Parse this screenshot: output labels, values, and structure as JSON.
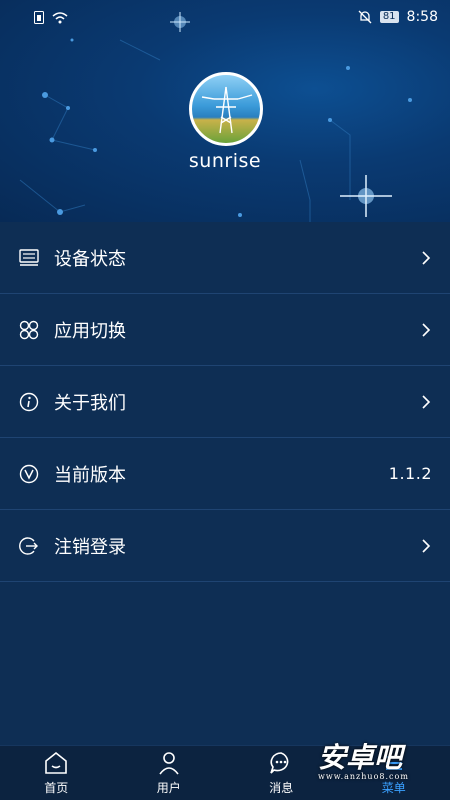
{
  "status_bar": {
    "time": "8:58",
    "battery": "81",
    "icons": [
      "sim-icon",
      "wifi-icon",
      "mute-icon",
      "battery-icon"
    ]
  },
  "profile": {
    "username": "sunrise"
  },
  "menu": {
    "items": [
      {
        "label": "设备状态",
        "icon": "device-icon"
      },
      {
        "label": "应用切换",
        "icon": "apps-icon"
      },
      {
        "label": "关于我们",
        "icon": "info-icon"
      },
      {
        "label": "当前版本",
        "icon": "version-icon",
        "value": "1.1.2"
      },
      {
        "label": "注销登录",
        "icon": "logout-icon"
      }
    ]
  },
  "tabbar": {
    "tabs": [
      {
        "label": "首页",
        "icon": "home-icon"
      },
      {
        "label": "用户",
        "icon": "user-icon"
      },
      {
        "label": "消息",
        "icon": "message-icon"
      },
      {
        "label": "菜单",
        "icon": "menu-icon",
        "active": true
      }
    ]
  },
  "watermark": {
    "text": "安卓吧",
    "sub": "www.anzhuo8.com"
  },
  "colors": {
    "background": "#0e2e54",
    "header": "#0a3a72",
    "accent": "#3aa0ff",
    "divider": "#1f4472"
  }
}
